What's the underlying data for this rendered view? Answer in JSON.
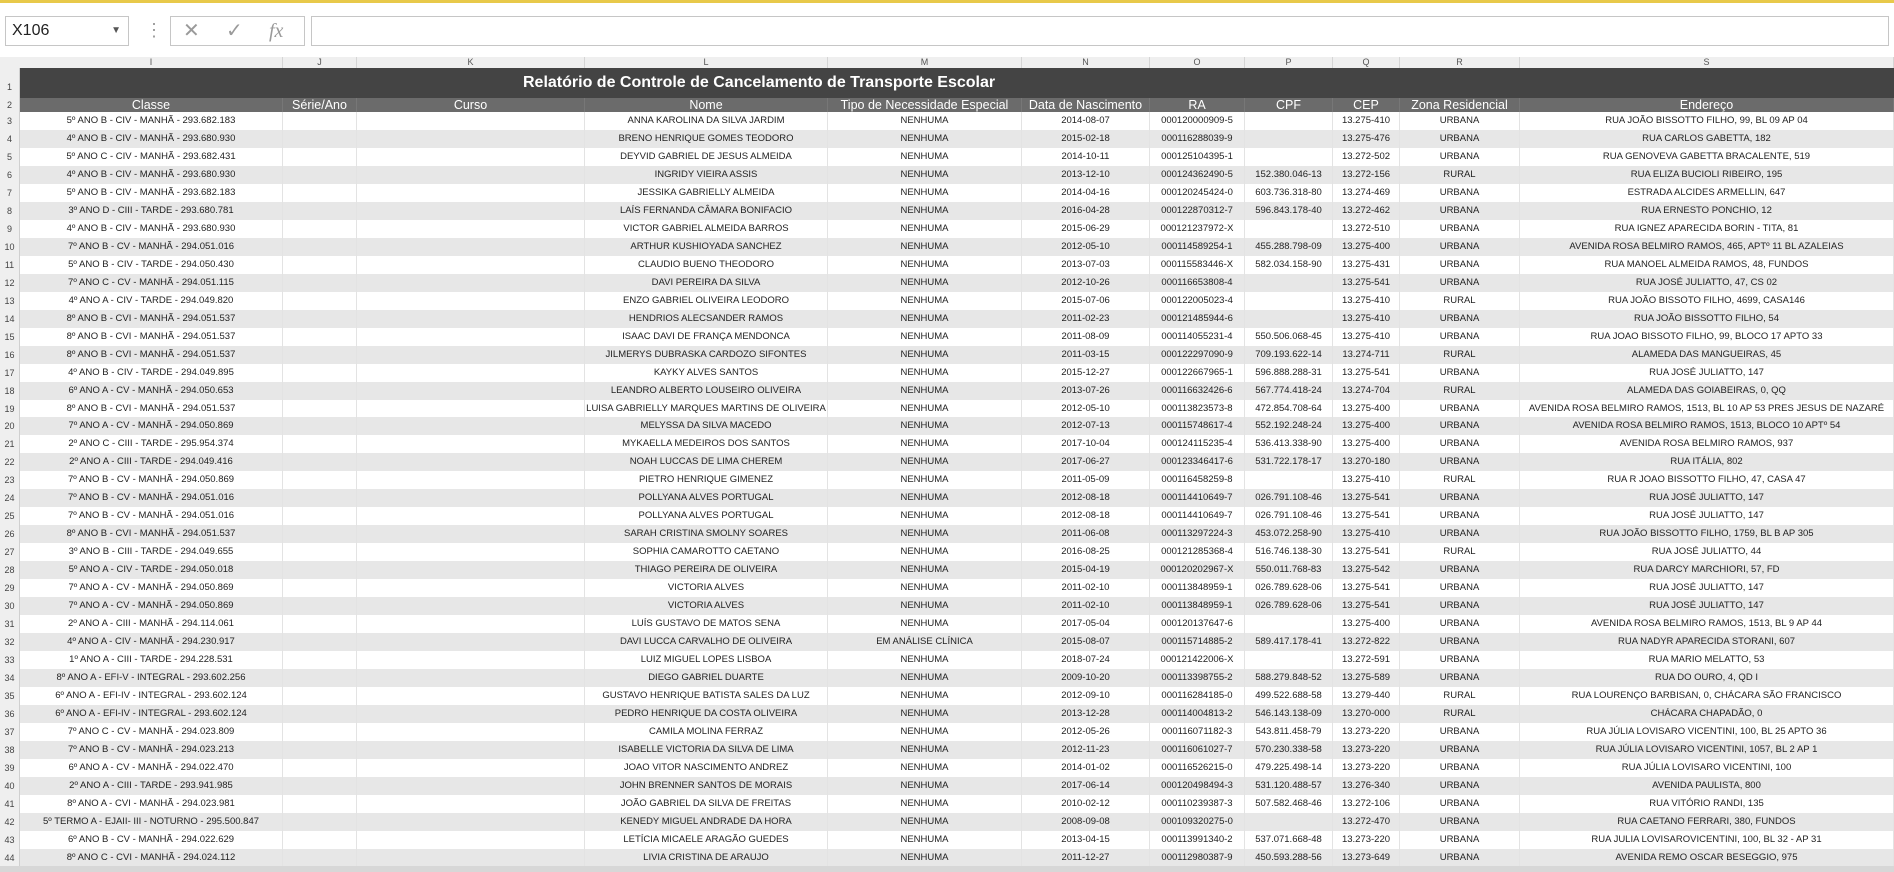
{
  "name_box": "X106",
  "formula_bar": {
    "cancel_glyph": "✕",
    "enter_glyph": "✓",
    "fx_glyph": "fx",
    "value": ""
  },
  "column_letters": [
    "I",
    "J",
    "K",
    "L",
    "M",
    "N",
    "O",
    "P",
    "Q",
    "R",
    "S"
  ],
  "title": "Relatório de Controle de Cancelamento de Transporte Escolar",
  "headers": [
    "Classe",
    "Série/Ano",
    "Curso",
    "Nome",
    "Tipo de Necessidade Especial",
    "Data de Nascimento",
    "RA",
    "CPF",
    "CEP",
    "Zona Residencial",
    "Endereço"
  ],
  "rows": [
    [
      "5º ANO B - CIV - MANHÃ - 293.682.183",
      "",
      "",
      "ANNA KAROLINA DA SILVA JARDIM",
      "NENHUMA",
      "2014-08-07",
      "000120000909-5",
      "",
      "13.275-410",
      "URBANA",
      "RUA JOÃO BISSOTTO FILHO, 99, BL 09 AP 04"
    ],
    [
      "4º ANO B - CIV - MANHÃ - 293.680.930",
      "",
      "",
      "BRENO HENRIQUE GOMES TEODORO",
      "NENHUMA",
      "2015-02-18",
      "000116288039-9",
      "",
      "13.275-476",
      "URBANA",
      "RUA CARLOS GABETTA, 182"
    ],
    [
      "5º ANO C - CIV - MANHÃ - 293.682.431",
      "",
      "",
      "DEYVID GABRIEL DE JESUS ALMEIDA",
      "NENHUMA",
      "2014-10-11",
      "000125104395-1",
      "",
      "13.272-502",
      "URBANA",
      "RUA GENOVEVA GABETTA BRACALENTE, 519"
    ],
    [
      "4º ANO B - CIV - MANHÃ - 293.680.930",
      "",
      "",
      "INGRIDY VIEIRA ASSIS",
      "NENHUMA",
      "2013-12-10",
      "000124362490-5",
      "152.380.046-13",
      "13.272-156",
      "RURAL",
      "RUA ELIZA BUCIOLI RIBEIRO, 195"
    ],
    [
      "5º ANO B - CIV - MANHÃ - 293.682.183",
      "",
      "",
      "JESSIKA GABRIELLY ALMEIDA",
      "NENHUMA",
      "2014-04-16",
      "000120245424-0",
      "603.736.318-80",
      "13.274-469",
      "URBANA",
      "ESTRADA ALCIDES ARMELLIN, 647"
    ],
    [
      "3º ANO D - CIII - TARDE - 293.680.781",
      "",
      "",
      "LAÍS FERNANDA CÂMARA BONIFACIO",
      "NENHUMA",
      "2016-04-28",
      "000122870312-7",
      "596.843.178-40",
      "13.272-462",
      "URBANA",
      "RUA ERNESTO PONCHIO, 12"
    ],
    [
      "4º ANO B - CIV - MANHÃ - 293.680.930",
      "",
      "",
      "VICTOR GABRIEL ALMEIDA BARROS",
      "NENHUMA",
      "2015-06-29",
      "000121237972-X",
      "",
      "13.272-510",
      "URBANA",
      "RUA IGNEZ APARECIDA BORIN - TITA, 81"
    ],
    [
      "7º ANO B - CV - MANHÃ - 294.051.016",
      "",
      "",
      "ARTHUR KUSHIOYADA SANCHEZ",
      "NENHUMA",
      "2012-05-10",
      "000114589254-1",
      "455.288.798-09",
      "13.275-400",
      "URBANA",
      "AVENIDA ROSA BELMIRO RAMOS, 465, APTº 11 BL AZALEIAS"
    ],
    [
      "5º ANO B - CIV - TARDE - 294.050.430",
      "",
      "",
      "CLAUDIO BUENO THEODORO",
      "NENHUMA",
      "2013-07-03",
      "000115583446-X",
      "582.034.158-90",
      "13.275-431",
      "URBANA",
      "RUA MANOEL ALMEIDA RAMOS, 48, FUNDOS"
    ],
    [
      "7º ANO C - CV - MANHÃ - 294.051.115",
      "",
      "",
      "DAVI PEREIRA DA SILVA",
      "NENHUMA",
      "2012-10-26",
      "000116653808-4",
      "",
      "13.275-541",
      "URBANA",
      "RUA JOSÉ JULIATTO, 47, CS 02"
    ],
    [
      "4º ANO A - CIV - TARDE - 294.049.820",
      "",
      "",
      "ENZO GABRIEL OLIVEIRA LEODORO",
      "NENHUMA",
      "2015-07-06",
      "000122005023-4",
      "",
      "13.275-410",
      "RURAL",
      "RUA JOÃO BISSOTO FILHO, 4699, CASA146"
    ],
    [
      "8º ANO B - CVI - MANHÃ - 294.051.537",
      "",
      "",
      "HENDRIOS ALECSANDER RAMOS",
      "NENHUMA",
      "2011-02-23",
      "000121485944-6",
      "",
      "13.275-410",
      "URBANA",
      "RUA JOÃO BISSOTTO FILHO, 54"
    ],
    [
      "8º ANO B - CVI - MANHÃ - 294.051.537",
      "",
      "",
      "ISAAC DAVI DE FRANÇA MENDONCA",
      "NENHUMA",
      "2011-08-09",
      "000114055231-4",
      "550.506.068-45",
      "13.275-410",
      "URBANA",
      "RUA JOAO BISSOTO FILHO, 99, BLOCO 17 APTO 33"
    ],
    [
      "8º ANO B - CVI - MANHÃ - 294.051.537",
      "",
      "",
      "JILMERYS DUBRASKA CARDOZO SIFONTES",
      "NENHUMA",
      "2011-03-15",
      "000122297090-9",
      "709.193.622-14",
      "13.274-711",
      "RURAL",
      "ALAMEDA DAS MANGUEIRAS, 45"
    ],
    [
      "4º ANO B - CIV - TARDE - 294.049.895",
      "",
      "",
      "KAYKY ALVES SANTOS",
      "NENHUMA",
      "2015-12-27",
      "000122667965-1",
      "596.888.288-31",
      "13.275-541",
      "URBANA",
      "RUA JOSÉ JULIATTO, 147"
    ],
    [
      "6º ANO A - CV - MANHÃ - 294.050.653",
      "",
      "",
      "LEANDRO ALBERTO LOUSEIRO OLIVEIRA",
      "NENHUMA",
      "2013-07-26",
      "000116632426-6",
      "567.774.418-24",
      "13.274-704",
      "RURAL",
      "ALAMEDA DAS GOIABEIRAS, 0, QQ"
    ],
    [
      "8º ANO B - CVI - MANHÃ - 294.051.537",
      "",
      "",
      "LUISA GABRIELLY MARQUES MARTINS DE OLIVEIRA",
      "NENHUMA",
      "2012-05-10",
      "000113823573-8",
      "472.854.708-64",
      "13.275-400",
      "URBANA",
      "AVENIDA ROSA BELMIRO RAMOS, 1513, BL 10 AP 53 PRES JESUS DE NAZARÉ"
    ],
    [
      "7º ANO A - CV - MANHÃ - 294.050.869",
      "",
      "",
      "MELYSSA DA SILVA MACEDO",
      "NENHUMA",
      "2012-07-13",
      "000115748617-4",
      "552.192.248-24",
      "13.275-400",
      "URBANA",
      "AVENIDA ROSA BELMIRO RAMOS, 1513, BLOCO 10 APTº 54"
    ],
    [
      "2º ANO C - CIII - TARDE - 295.954.374",
      "",
      "",
      "MYKAELLA MEDEIROS DOS SANTOS",
      "NENHUMA",
      "2017-10-04",
      "000124115235-4",
      "536.413.338-90",
      "13.275-400",
      "URBANA",
      "AVENIDA ROSA BELMIRO RAMOS, 937"
    ],
    [
      "2º ANO A - CIII - TARDE - 294.049.416",
      "",
      "",
      "NOAH LUCCAS DE LIMA CHEREM",
      "NENHUMA",
      "2017-06-27",
      "000123346417-6",
      "531.722.178-17",
      "13.270-180",
      "URBANA",
      "RUA ITÁLIA, 802"
    ],
    [
      "7º ANO B - CV - MANHÃ - 294.050.869",
      "",
      "",
      "PIETRO HENRIQUE GIMENEZ",
      "NENHUMA",
      "2011-05-09",
      "000116458259-8",
      "",
      "13.275-410",
      "RURAL",
      "RUA R JOAO BISSOTTO FILHO, 47, CASA 47"
    ],
    [
      "7º ANO B - CV - MANHÃ - 294.051.016",
      "",
      "",
      "POLLYANA ALVES PORTUGAL",
      "NENHUMA",
      "2012-08-18",
      "000114410649-7",
      "026.791.108-46",
      "13.275-541",
      "URBANA",
      "RUA JOSÉ JULIATTO, 147"
    ],
    [
      "7º ANO B - CV - MANHÃ - 294.051.016",
      "",
      "",
      "POLLYANA ALVES PORTUGAL",
      "NENHUMA",
      "2012-08-18",
      "000114410649-7",
      "026.791.108-46",
      "13.275-541",
      "URBANA",
      "RUA JOSÉ JULIATTO, 147"
    ],
    [
      "8º ANO B - CVI - MANHÃ - 294.051.537",
      "",
      "",
      "SARAH CRISTINA SMOLNY SOARES",
      "NENHUMA",
      "2011-06-08",
      "000113297224-3",
      "453.072.258-90",
      "13.275-410",
      "URBANA",
      "RUA JOÃO BISSOTTO FILHO, 1759, BL B AP 305"
    ],
    [
      "3º ANO B - CIII - TARDE - 294.049.655",
      "",
      "",
      "SOPHIA CAMAROTTO CAETANO",
      "NENHUMA",
      "2016-08-25",
      "000121285368-4",
      "516.746.138-30",
      "13.275-541",
      "RURAL",
      "RUA JOSÉ JULIATTO, 44"
    ],
    [
      "5º ANO A - CIV - TARDE - 294.050.018",
      "",
      "",
      "THIAGO PEREIRA DE OLIVEIRA",
      "NENHUMA",
      "2015-04-19",
      "000120202967-X",
      "550.011.768-83",
      "13.275-542",
      "URBANA",
      "RUA DARCY MARCHIORI, 57, FD"
    ],
    [
      "7º ANO A - CV - MANHÃ - 294.050.869",
      "",
      "",
      "VICTORIA ALVES",
      "NENHUMA",
      "2011-02-10",
      "000113848959-1",
      "026.789.628-06",
      "13.275-541",
      "URBANA",
      "RUA JOSÉ JULIATTO, 147"
    ],
    [
      "7º ANO A - CV - MANHÃ - 294.050.869",
      "",
      "",
      "VICTORIA ALVES",
      "NENHUMA",
      "2011-02-10",
      "000113848959-1",
      "026.789.628-06",
      "13.275-541",
      "URBANA",
      "RUA JOSÉ JULIATTO, 147"
    ],
    [
      "2º ANO A - CIII - MANHÃ - 294.114.061",
      "",
      "",
      "LUÍS GUSTAVO DE MATOS SENA",
      "NENHUMA",
      "2017-05-04",
      "000120137647-6",
      "",
      "13.275-400",
      "URBANA",
      "AVENIDA ROSA BELMIRO RAMOS, 1513, BL 9 AP 44"
    ],
    [
      "4º ANO A - CIV - MANHÃ - 294.230.917",
      "",
      "",
      "DAVI LUCCA CARVALHO DE OLIVEIRA",
      "EM ANÁLISE CLÍNICA",
      "2015-08-07",
      "000115714885-2",
      "589.417.178-41",
      "13.272-822",
      "URBANA",
      "RUA NADYR APARECIDA STORANI, 607"
    ],
    [
      "1º ANO A - CIII - TARDE - 294.228.531",
      "",
      "",
      "LUIZ MIGUEL LOPES LISBOA",
      "NENHUMA",
      "2018-07-24",
      "000121422006-X",
      "",
      "13.272-591",
      "URBANA",
      "RUA MARIO MELATTO, 53"
    ],
    [
      "8º ANO A - EFI-V - INTEGRAL - 293.602.256",
      "",
      "",
      "DIEGO GABRIEL DUARTE",
      "NENHUMA",
      "2009-10-20",
      "000113398755-2",
      "588.279.848-52",
      "13.275-589",
      "URBANA",
      "RUA DO OURO, 4, QD I"
    ],
    [
      "6º ANO A - EFI-IV - INTEGRAL - 293.602.124",
      "",
      "",
      "GUSTAVO HENRIQUE BATISTA SALES DA LUZ",
      "NENHUMA",
      "2012-09-10",
      "000116284185-0",
      "499.522.688-58",
      "13.279-440",
      "RURAL",
      "RUA LOURENÇO BARBISAN, 0, CHÁCARA SÃO FRANCISCO"
    ],
    [
      "6º ANO A - EFI-IV - INTEGRAL - 293.602.124",
      "",
      "",
      "PEDRO HENRIQUE DA COSTA OLIVEIRA",
      "NENHUMA",
      "2013-12-28",
      "000114004813-2",
      "546.143.138-09",
      "13.270-000",
      "RURAL",
      "CHÁCARA CHAPADÃO, 0"
    ],
    [
      "7º ANO C - CV - MANHÃ - 294.023.809",
      "",
      "",
      "CAMILA MOLINA FERRAZ",
      "NENHUMA",
      "2012-05-26",
      "000116071182-3",
      "543.811.458-79",
      "13.273-220",
      "URBANA",
      "RUA JÚLIA LOVISARO VICENTINI, 100, BL 25 APTO 36"
    ],
    [
      "7º ANO B - CV - MANHÃ - 294.023.213",
      "",
      "",
      "ISABELLE VICTORIA DA SILVA DE LIMA",
      "NENHUMA",
      "2012-11-23",
      "000116061027-7",
      "570.230.338-58",
      "13.273-220",
      "URBANA",
      "RUA JÚLIA LOVISARO VICENTINI, 1057, BL 2 AP 1"
    ],
    [
      "6º ANO A - CV - MANHÃ - 294.022.470",
      "",
      "",
      "JOAO VITOR NASCIMENTO ANDREZ",
      "NENHUMA",
      "2014-01-02",
      "000116526215-0",
      "479.225.498-14",
      "13.273-220",
      "URBANA",
      "RUA JÚLIA LOVISARO VICENTINI, 100"
    ],
    [
      "2º ANO A - CIII - TARDE - 293.941.985",
      "",
      "",
      "JOHN BRENNER SANTOS DE MORAIS",
      "NENHUMA",
      "2017-06-14",
      "000120498494-3",
      "531.120.488-57",
      "13.276-340",
      "URBANA",
      "AVENIDA PAULISTA, 800"
    ],
    [
      "8º ANO A - CVI - MANHÃ - 294.023.981",
      "",
      "",
      "JOÃO GABRIEL DA SILVA DE FREITAS",
      "NENHUMA",
      "2010-02-12",
      "000110239387-3",
      "507.582.468-46",
      "13.272-106",
      "URBANA",
      "RUA VITÓRIO RANDI, 135"
    ],
    [
      "5º TERMO A - EJAII- III - NOTURNO - 295.500.847",
      "",
      "",
      "KENEDY MIGUEL ANDRADE DA HORA",
      "NENHUMA",
      "2008-09-08",
      "000109320275-0",
      "",
      "13.272-470",
      "URBANA",
      "RUA CAETANO FERRARI, 380, FUNDOS"
    ],
    [
      "6º ANO B - CV - MANHÃ - 294.022.629",
      "",
      "",
      "LETÍCIA MICAELE ARAGÃO GUEDES",
      "NENHUMA",
      "2013-04-15",
      "000113991340-2",
      "537.071.668-48",
      "13.273-220",
      "URBANA",
      "RUA JULIA LOVISAROVICENTINI, 100, BL 32 - AP 31"
    ],
    [
      "8º ANO C - CVI - MANHÃ - 294.024.112",
      "",
      "",
      "LIVIA CRISTINA DE ARAUJO",
      "NENHUMA",
      "2011-12-27",
      "000112980387-9",
      "450.593.288-56",
      "13.273-649",
      "URBANA",
      "AVENIDA REMO OSCAR BESEGGIO, 975"
    ]
  ]
}
